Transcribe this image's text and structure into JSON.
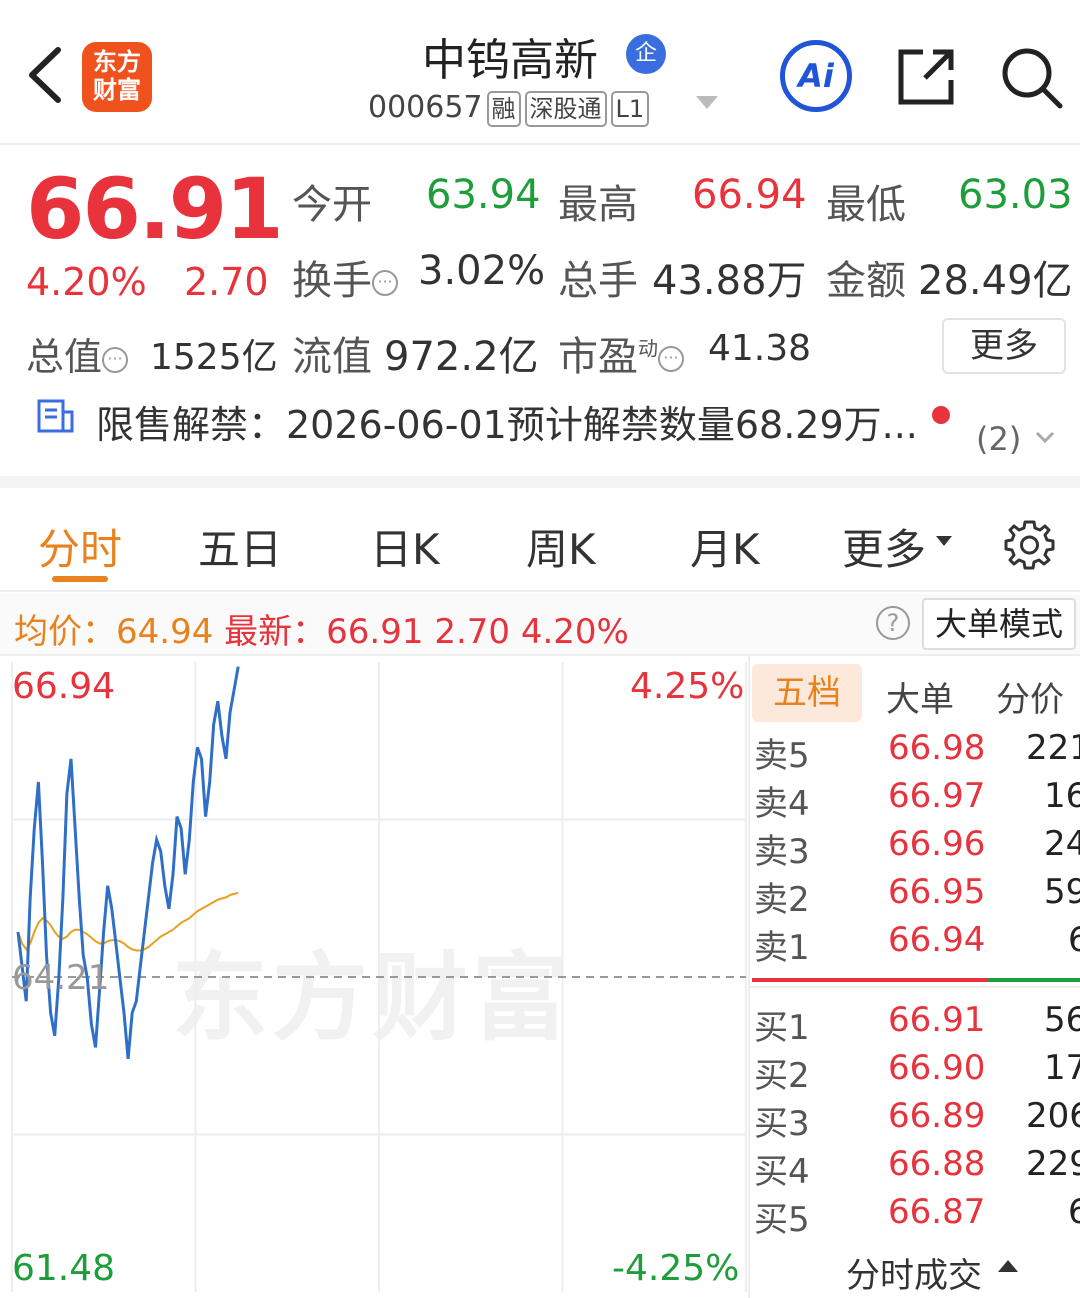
{
  "header": {
    "logo_text_line1": "东方",
    "logo_text_line2": "财富",
    "title": "中钨高新",
    "badge": "企",
    "code": "000657",
    "tags": [
      "融",
      "深股通",
      "L1"
    ],
    "ai_label": "Ai"
  },
  "quote": {
    "price": "66.91",
    "pct": "4.20%",
    "change": "2.70",
    "open_label": "今开",
    "open": "63.94",
    "high_label": "最高",
    "high": "66.94",
    "low_label": "最低",
    "low": "63.03",
    "turnover_label": "换手",
    "turnover": "3.02%",
    "volume_label": "总手",
    "volume": "43.88万",
    "amount_label": "金额",
    "amount": "28.49亿",
    "mktcap_label": "总值",
    "mktcap": "1525亿",
    "float_label": "流值",
    "float": "972.2亿",
    "pe_label": "市盈",
    "pe_sup": "动",
    "pe": "41.38",
    "more": "更多"
  },
  "notice": {
    "text": "限售解禁：2026-06-01预计解禁数量68.29万...",
    "count": "(2)"
  },
  "tabs": [
    "分时",
    "五日",
    "日K",
    "周K",
    "月K",
    "更多"
  ],
  "infobar": {
    "avg_label": "均价：",
    "avg": "64.94",
    "last_label": "最新：",
    "last": "66.91",
    "change": "2.70",
    "pct": "4.20%",
    "help": "?",
    "mode": "大单模式"
  },
  "chart_data": {
    "type": "line",
    "y_left_top": "66.94",
    "y_left_base": "64.21",
    "y_left_bottom": "61.48",
    "y_right_top": "4.25%",
    "y_right_bottom": "-4.25%",
    "ylim": [
      61.48,
      66.94
    ],
    "base": 64.21,
    "watermark": "东方财富",
    "series": [
      {
        "color": "#2f6fc8",
        "values": [
          64.6,
          64.3,
          64.0,
          64.9,
          65.5,
          65.9,
          65.2,
          64.4,
          63.9,
          63.7,
          64.2,
          64.9,
          65.8,
          66.1,
          65.5,
          64.9,
          64.4,
          64.2,
          63.8,
          63.6,
          64.1,
          64.6,
          65.0,
          64.8,
          64.5,
          64.2,
          63.9,
          63.5,
          63.9,
          64.0,
          64.3,
          64.6,
          64.9,
          65.2,
          65.4,
          65.3,
          65.0,
          64.8,
          65.1,
          65.6,
          65.5,
          65.1,
          65.4,
          65.9,
          66.2,
          66.1,
          65.6,
          65.9,
          66.4,
          66.6,
          66.3,
          66.1,
          66.5,
          66.7,
          66.9
        ]
      },
      {
        "color": "#e8a020",
        "values": [
          64.6,
          64.5,
          64.45,
          64.5,
          64.6,
          64.68,
          64.72,
          64.7,
          64.66,
          64.6,
          64.56,
          64.54,
          64.56,
          64.6,
          64.62,
          64.62,
          64.6,
          64.58,
          64.55,
          64.52,
          64.5,
          64.5,
          64.52,
          64.53,
          64.53,
          64.52,
          64.5,
          64.47,
          64.45,
          64.44,
          64.44,
          64.45,
          64.47,
          64.5,
          64.53,
          64.56,
          64.58,
          64.6,
          64.62,
          64.65,
          64.68,
          64.7,
          64.72,
          64.75,
          64.78,
          64.8,
          64.82,
          64.84,
          64.86,
          64.88,
          64.89,
          64.9,
          64.92,
          64.93,
          64.94
        ]
      }
    ]
  },
  "book": {
    "tabs": [
      "五档",
      "大单",
      "分价"
    ],
    "asks": [
      {
        "label": "卖5",
        "price": "66.98",
        "vol": "221"
      },
      {
        "label": "卖4",
        "price": "66.97",
        "vol": "16"
      },
      {
        "label": "卖3",
        "price": "66.96",
        "vol": "24"
      },
      {
        "label": "卖2",
        "price": "66.95",
        "vol": "59"
      },
      {
        "label": "卖1",
        "price": "66.94",
        "vol": "6"
      }
    ],
    "bids": [
      {
        "label": "买1",
        "price": "66.91",
        "vol": "56"
      },
      {
        "label": "买2",
        "price": "66.90",
        "vol": "17"
      },
      {
        "label": "买3",
        "price": "66.89",
        "vol": "206"
      },
      {
        "label": "买4",
        "price": "66.88",
        "vol": "229"
      },
      {
        "label": "买5",
        "price": "66.87",
        "vol": "6"
      }
    ],
    "ticks": "分时成交"
  }
}
